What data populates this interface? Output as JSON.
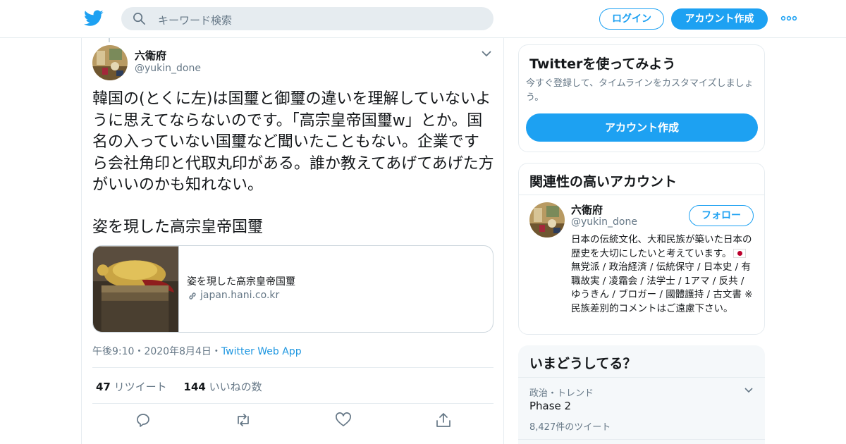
{
  "header": {
    "search_placeholder": "キーワード検索",
    "login_label": "ログイン",
    "signup_label": "アカウント作成",
    "brand_color": "#1da1f2"
  },
  "tweet": {
    "author_name": "六衛府",
    "author_handle": "@yukin_done",
    "text": "韓国の(とくに左)は国璽と御璽の違いを理解していないように思えてならないのです。「高宗皇帝国璽w」とか。国名の入っていない国璽など聞いたこともない。企業ですら会社角印と代取丸印がある。誰か教えてあげてあげた方がいいのかも知れない。",
    "text2": "姿を現した高宗皇帝国璽",
    "card": {
      "title": "姿を現した高宗皇帝国璽",
      "domain": "japan.hani.co.kr"
    },
    "time": "午後9:10",
    "date": "2020年8月4日",
    "source": "Twitter Web App",
    "retweet_count": "47",
    "retweet_label": "リツイート",
    "like_count": "144",
    "like_label": "いいねの数"
  },
  "sidebar": {
    "try": {
      "title": "Twitterを使ってみよう",
      "subtitle": "今すぐ登録して、タイムラインをカスタマイズしましょう。",
      "button": "アカウント作成"
    },
    "related": {
      "title": "関連性の高いアカウント",
      "name": "六衛府",
      "handle": "@yukin_done",
      "follow_label": "フォロー",
      "bio_before_flag": "日本の伝統文化、大和民族が築いた日本の歴史を大切にしたいと考えています。",
      "bio_after_flag": "無党派 / 政治経済 / 伝統保守 / 日本史 / 有職故実 / 凌霜会 / 法学士 / 1アマ / 反共 / ゆうきん / ブロガー / 國體護持 / 古文書 ※民族差別的コメントはご遠慮下さい。"
    },
    "trends": {
      "title": "いまどうしてる？",
      "category": "政治・トレンド",
      "name": "Phase 2",
      "count": "8,427件のツイート"
    }
  }
}
